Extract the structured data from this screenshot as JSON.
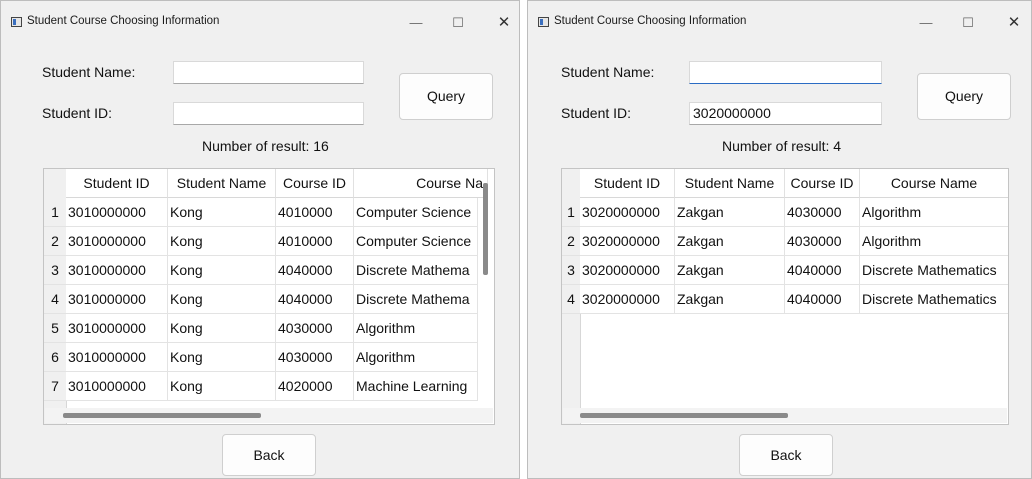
{
  "left_window": {
    "title": "Student Course Choosing Information",
    "controls": {
      "minimize": "—",
      "maximize": "☐",
      "close": "✕"
    },
    "form": {
      "name_label": "Student Name:",
      "id_label": "Student ID:",
      "name_value": "",
      "id_value": "",
      "query_label": "Query"
    },
    "result_text": "Number of result: 16",
    "table": {
      "headers": [
        "Student ID",
        "Student Name",
        "Course ID",
        "Course Na"
      ],
      "rows": [
        {
          "num": "1",
          "student_id": "3010000000",
          "student_name": "Kong",
          "course_id": "4010000",
          "course_name": "Computer Science"
        },
        {
          "num": "2",
          "student_id": "3010000000",
          "student_name": "Kong",
          "course_id": "4010000",
          "course_name": "Computer Science"
        },
        {
          "num": "3",
          "student_id": "3010000000",
          "student_name": "Kong",
          "course_id": "4040000",
          "course_name": "Discrete Mathema"
        },
        {
          "num": "4",
          "student_id": "3010000000",
          "student_name": "Kong",
          "course_id": "4040000",
          "course_name": "Discrete Mathema"
        },
        {
          "num": "5",
          "student_id": "3010000000",
          "student_name": "Kong",
          "course_id": "4030000",
          "course_name": "Algorithm"
        },
        {
          "num": "6",
          "student_id": "3010000000",
          "student_name": "Kong",
          "course_id": "4030000",
          "course_name": "Algorithm"
        },
        {
          "num": "7",
          "student_id": "3010000000",
          "student_name": "Kong",
          "course_id": "4020000",
          "course_name": "Machine Learning"
        }
      ]
    },
    "back_label": "Back"
  },
  "right_window": {
    "title": "Student Course Choosing Information",
    "controls": {
      "minimize": "—",
      "maximize": "☐",
      "close": "✕"
    },
    "form": {
      "name_label": "Student Name:",
      "id_label": "Student ID:",
      "name_value": "",
      "id_value": "3020000000",
      "query_label": "Query"
    },
    "result_text": "Number of result: 4",
    "table": {
      "headers": [
        "Student ID",
        "Student Name",
        "Course ID",
        "Course Name"
      ],
      "rows": [
        {
          "num": "1",
          "student_id": "3020000000",
          "student_name": "Zakgan",
          "course_id": "4030000",
          "course_name": "Algorithm"
        },
        {
          "num": "2",
          "student_id": "3020000000",
          "student_name": "Zakgan",
          "course_id": "4030000",
          "course_name": "Algorithm"
        },
        {
          "num": "3",
          "student_id": "3020000000",
          "student_name": "Zakgan",
          "course_id": "4040000",
          "course_name": "Discrete Mathematics"
        },
        {
          "num": "4",
          "student_id": "3020000000",
          "student_name": "Zakgan",
          "course_id": "4040000",
          "course_name": "Discrete Mathematics"
        }
      ]
    },
    "back_label": "Back"
  }
}
